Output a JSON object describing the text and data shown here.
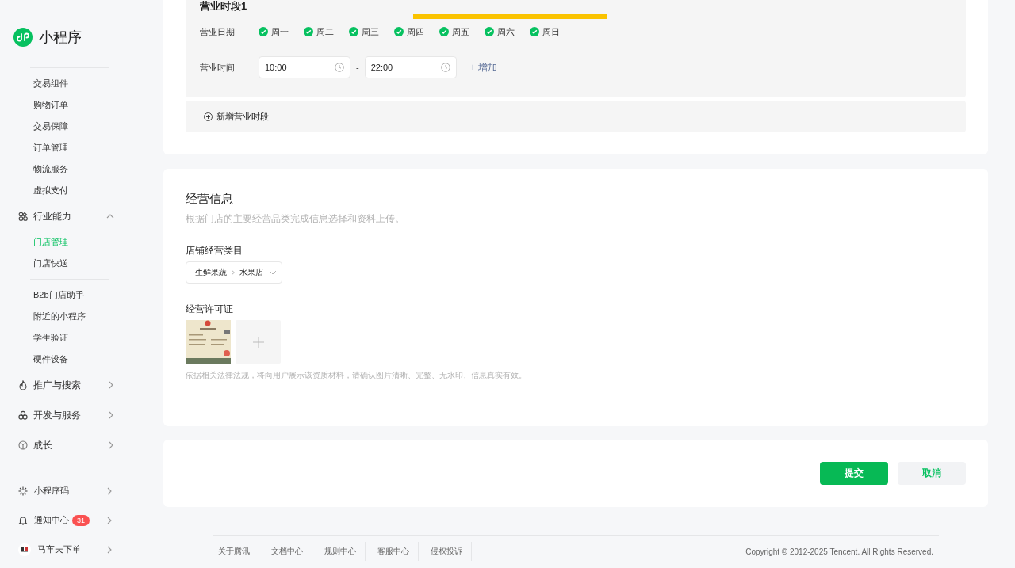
{
  "sidebar": {
    "logo_text": "小程序",
    "nav": [
      {
        "kind": "divider"
      },
      {
        "kind": "item",
        "label": "交易组件",
        "selected": false
      },
      {
        "kind": "item",
        "label": "购物订单",
        "selected": false
      },
      {
        "kind": "item",
        "label": "交易保障",
        "selected": false
      },
      {
        "kind": "item",
        "label": "订单管理",
        "selected": false
      },
      {
        "kind": "item",
        "label": "物流服务",
        "selected": false
      },
      {
        "kind": "item",
        "label": "虚拟支付",
        "selected": false
      },
      {
        "kind": "group",
        "label": "行业能力",
        "expanded": true
      },
      {
        "kind": "item",
        "label": "门店管理",
        "selected": true
      },
      {
        "kind": "item",
        "label": "门店快送",
        "selected": false
      },
      {
        "kind": "divider"
      },
      {
        "kind": "item",
        "label": "B2b门店助手",
        "selected": false
      },
      {
        "kind": "item",
        "label": "附近的小程序",
        "selected": false
      },
      {
        "kind": "item",
        "label": "学生验证",
        "selected": false
      },
      {
        "kind": "item",
        "label": "硬件设备",
        "selected": false
      },
      {
        "kind": "group",
        "label": "推广与搜索",
        "expanded": false
      },
      {
        "kind": "group",
        "label": "开发与服务",
        "expanded": false
      },
      {
        "kind": "group",
        "label": "成长",
        "expanded": false
      }
    ],
    "bottom": [
      {
        "label": "小程序码"
      },
      {
        "label": "通知中心",
        "badge": "31"
      },
      {
        "label": "马车夫下单"
      }
    ]
  },
  "hours": {
    "title": "营业时段1",
    "days_label": "营业日期",
    "days": [
      {
        "label": "周一",
        "checked": true
      },
      {
        "label": "周二",
        "checked": true
      },
      {
        "label": "周三",
        "checked": true
      },
      {
        "label": "周四",
        "checked": true
      },
      {
        "label": "周五",
        "checked": true
      },
      {
        "label": "周六",
        "checked": true
      },
      {
        "label": "周日",
        "checked": true
      }
    ],
    "time_label": "营业时间",
    "start": "10:00",
    "separator": "-",
    "end": "22:00",
    "add_link": "+ 增加",
    "add_period": "新增营业时段"
  },
  "business_info": {
    "title": "经营信息",
    "description": "根据门店的主要经营品类完成信息选择和资料上传。",
    "category_label": "店铺经营类目",
    "category": [
      "生鲜果蔬",
      "水果店"
    ],
    "license_label": "经营许可证",
    "license_images": [
      {
        "kind": "picture"
      }
    ],
    "hint": "依据相关法律法规，将向用户展示该资质材料，请确认图片清晰、完整、无水印、信息真实有效。"
  },
  "actions": [
    {
      "kind": "primary",
      "label": "提交"
    },
    {
      "kind": "secondary",
      "label": "取消"
    }
  ],
  "footer": {
    "links": [
      "关于腾讯",
      "文档中心",
      "规则中心",
      "客服中心",
      "侵权投诉"
    ],
    "copyright": "Copyright © 2012-2025 Tencent. All Rights Reserved."
  }
}
